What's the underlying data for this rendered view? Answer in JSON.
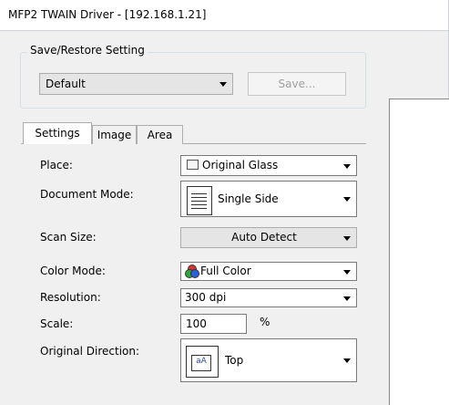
{
  "window": {
    "title": "MFP2 TWAIN Driver - [192.168.1.21]"
  },
  "save_restore": {
    "group_label": "Save/Restore Setting",
    "selected": "Default",
    "save_button": "Save..."
  },
  "tabs": [
    {
      "label": "Settings",
      "active": true
    },
    {
      "label": "Image",
      "active": false
    },
    {
      "label": "Area",
      "active": false
    }
  ],
  "settings": {
    "place": {
      "label": "Place:",
      "value": "Original Glass",
      "icon": "glass-icon"
    },
    "document_mode": {
      "label": "Document Mode:",
      "value": "Single Side",
      "icon": "document-icon"
    },
    "scan_size": {
      "label": "Scan Size:",
      "value": "Auto Detect"
    },
    "color_mode": {
      "label": "Color Mode:",
      "value": "Full Color",
      "icon": "rgb-dots-icon"
    },
    "resolution": {
      "label": "Resolution:",
      "value": "300 dpi"
    },
    "scale": {
      "label": "Scale:",
      "value": "100",
      "unit": "%"
    },
    "original_direction": {
      "label": "Original Direction:",
      "value": "Top",
      "icon": "direction-icon",
      "icon_text": "aA"
    }
  },
  "colors": {
    "window_bg": "#f0f0f0",
    "field_border": "#7a7a7a",
    "disabled_text": "#a0a0a0"
  }
}
